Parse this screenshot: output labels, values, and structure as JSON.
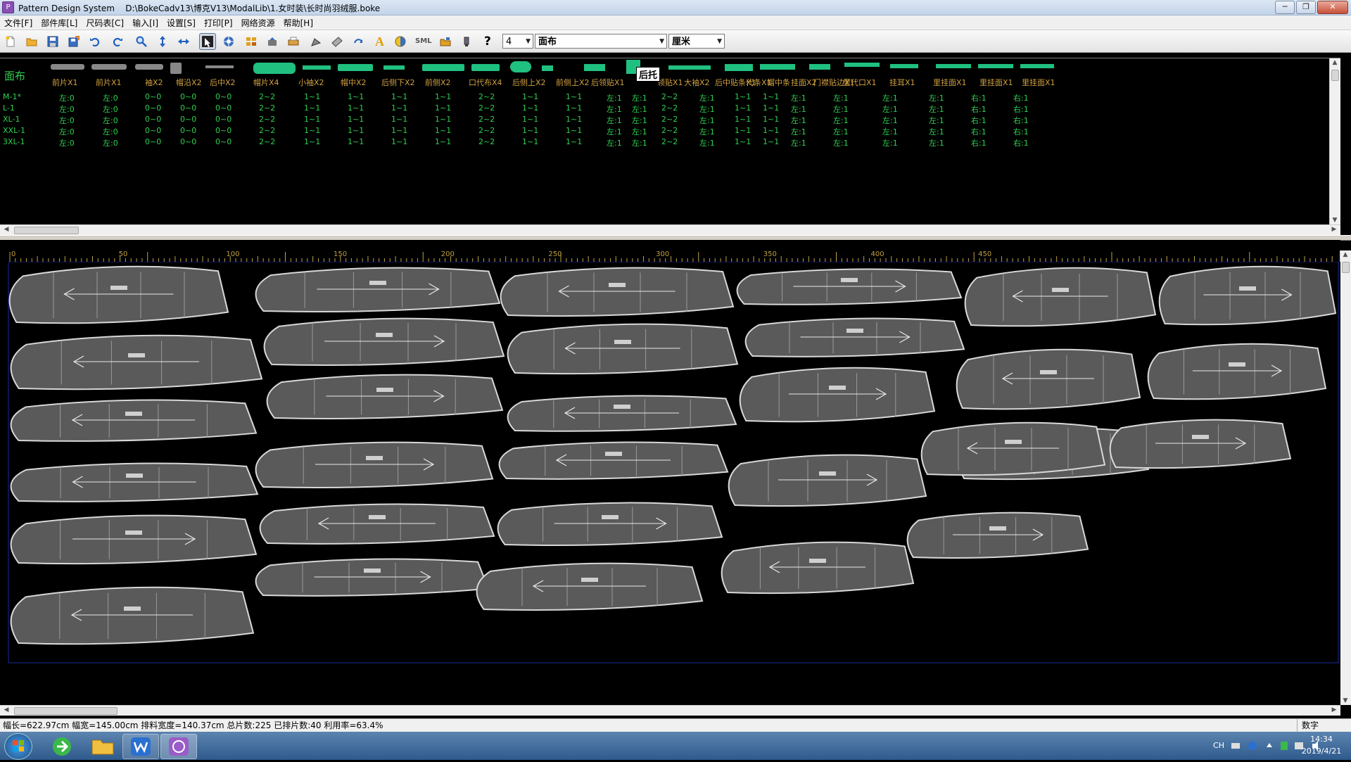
{
  "window": {
    "app_name": "Pattern Design System",
    "file_path": "D:\\BokeCadv13\\博克V13\\ModalLib\\1.女时装\\长时尚羽绒服.boke",
    "buttons": {
      "minimize": "─",
      "restore": "❐",
      "close": "✕"
    }
  },
  "menu": [
    "文件[F]",
    "部件库[L]",
    "尺码表[C]",
    "输入[I]",
    "设置[S]",
    "打印[P]",
    "网络资源",
    "帮助[H]"
  ],
  "toolbar": {
    "tools": [
      "new",
      "open",
      "save",
      "save-as",
      "undo",
      "redo",
      "zoom",
      "move-vertical",
      "move-horizontal",
      "select",
      "layout",
      "auto-arrange",
      "arrange",
      "print",
      "plot",
      "measure",
      "rotate",
      "text",
      "fill",
      "sml",
      "folder",
      "marker",
      "help"
    ],
    "text_tool": "A",
    "sml_tool": "SML",
    "help_tool": "?",
    "layer_value": "4",
    "fabric_value": "面布",
    "unit_value": "厘米",
    "selected_tool": "select"
  },
  "colors": {
    "accent_green": "#20c080",
    "header_text": "#d0a040",
    "value_text": "#30d050",
    "piece_fill": "#5a5a5a"
  },
  "table": {
    "fabric_label": "面布",
    "tooltip": "后托",
    "columns": [
      "前片X1",
      "前片X1",
      "袖X2",
      "帽沿X2",
      "后中X2",
      "帽片X4",
      "小袖X2",
      "帽中X2",
      "后侧下X2",
      "前侧X2",
      "口代布X4",
      "后侧上X2",
      "前侧上X2",
      "后领贴X1",
      "后托",
      "领贴X1",
      "大袖X2",
      "后中贴条X1",
      "代条X1",
      "帽中条",
      "挂面X2",
      "门襟贴边X1",
      "里代口X1",
      "挂耳X1",
      "里挂面X1",
      "里挂面X1",
      "里挂面X1"
    ],
    "rows": [
      {
        "size": "M-1*",
        "values": [
          "左:0",
          "左:0",
          "0~0",
          "0~0",
          "0~0",
          "2~2",
          "1~1",
          "1~1",
          "1~1",
          "1~1",
          "2~2",
          "1~1",
          "1~1",
          "左:1",
          "左:1",
          "2~2",
          "左:1",
          "1~1",
          "1~1",
          "左:1",
          "左:1",
          "左:1",
          "左:1",
          "右:1",
          "右:1"
        ]
      },
      {
        "size": "L-1",
        "values": [
          "左:0",
          "左:0",
          "0~0",
          "0~0",
          "0~0",
          "2~2",
          "1~1",
          "1~1",
          "1~1",
          "1~1",
          "2~2",
          "1~1",
          "1~1",
          "左:1",
          "左:1",
          "2~2",
          "左:1",
          "1~1",
          "1~1",
          "左:1",
          "左:1",
          "左:1",
          "左:1",
          "右:1",
          "右:1"
        ]
      },
      {
        "size": "XL-1",
        "values": [
          "左:0",
          "左:0",
          "0~0",
          "0~0",
          "0~0",
          "2~2",
          "1~1",
          "1~1",
          "1~1",
          "1~1",
          "2~2",
          "1~1",
          "1~1",
          "左:1",
          "左:1",
          "2~2",
          "左:1",
          "1~1",
          "1~1",
          "左:1",
          "左:1",
          "左:1",
          "左:1",
          "右:1",
          "右:1"
        ]
      },
      {
        "size": "XXL-1",
        "values": [
          "左:0",
          "左:0",
          "0~0",
          "0~0",
          "0~0",
          "2~2",
          "1~1",
          "1~1",
          "1~1",
          "1~1",
          "2~2",
          "1~1",
          "1~1",
          "左:1",
          "左:1",
          "2~2",
          "左:1",
          "1~1",
          "1~1",
          "左:1",
          "左:1",
          "左:1",
          "左:1",
          "右:1",
          "右:1"
        ]
      },
      {
        "size": "3XL-1",
        "values": [
          "左:0",
          "左:0",
          "0~0",
          "0~0",
          "0~0",
          "2~2",
          "1~1",
          "1~1",
          "1~1",
          "1~1",
          "2~2",
          "1~1",
          "1~1",
          "左:1",
          "左:1",
          "2~2",
          "左:1",
          "1~1",
          "1~1",
          "左:1",
          "左:1",
          "左:1",
          "左:1",
          "右:1",
          "右:1"
        ]
      }
    ]
  },
  "ruler": {
    "labels": [
      "0",
      "50",
      "100",
      "150",
      "200",
      "250",
      "300",
      "350",
      "400",
      "450"
    ],
    "unit": "cm"
  },
  "status": {
    "text": "幅长=622.97cm 幅宽=145.00cm 排料宽度=140.37cm 总片数:225 已排片数:40 利用率=63.4%",
    "mode": "数字"
  },
  "taskbar": {
    "apps": [
      "start-button",
      "browser",
      "file-explorer",
      "wps-office",
      "pattern-design-system"
    ],
    "tray": {
      "lang": "CH",
      "time": "14:34",
      "date": "2019/4/21"
    }
  }
}
